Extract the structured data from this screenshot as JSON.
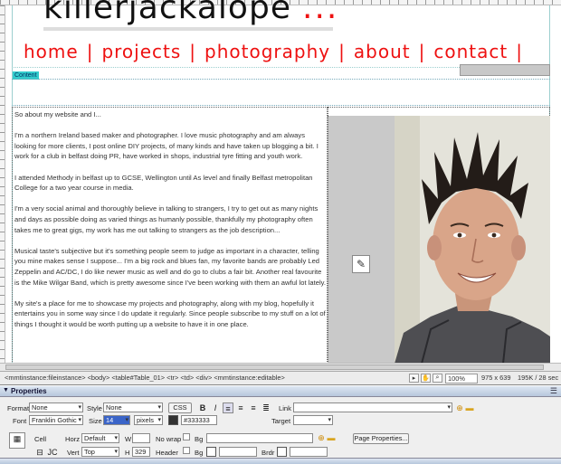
{
  "site": {
    "logo_text": "killerjackalope",
    "logo_dots": "...",
    "nav": [
      {
        "label": "home"
      },
      {
        "label": "projects"
      },
      {
        "label": "photography"
      },
      {
        "label": "about"
      },
      {
        "label": "contact"
      }
    ],
    "nav_separator": "|",
    "content_tag": "Content"
  },
  "article": {
    "paragraphs": [
      "So about my website and I...",
      "I'm a northern Ireland based maker and photographer. I love music photography and am always looking for more clients, I post online DIY projects, of many kinds and have taken up blogging a bit. I work for a club in belfast doing PR, have worked in shops, industrial tyre fitting and youth work.",
      "I attended Methody in belfast up to GCSE, Wellington until As level and finally Belfast metropolitan College for a two year course in media.",
      "I'm a very social animal and thoroughly believe in talking to strangers, I try to get out as many nights and days as possible doing as varied things as humanly possible, thankfully my photography often takes me to great gigs, my work has me out talking to strangers as the job description...",
      "Musical taste's subjective but it's something people seem to judge as important in a character, telling you mine makes sense I suppose... I'm a big rock and blues fan, my favorite bands are probably Led Zeppelin and AC/DC, I do like newer music as well and do go to clubs a fair bit. Another real favourite is the Mike Wilgar Band, which is pretty awesome since I've been working with them an awful lot lately.",
      "My site's a place for me to showcase my projects and photography, along with my blog, hopefully it entertains you in some way since I do update it regularly. Since people subscribe to my stuff on a lot of things I thought it would be worth putting up a website to have it in one place."
    ]
  },
  "status_bar": {
    "tag_path": "<mmtinstance:fileinstance> <body> <table#Table_01> <tr> <td> <div> <mmtinstance:editable>",
    "zoom": "100%",
    "dimensions": "975 x 639",
    "file_info": "195K / 28 sec"
  },
  "properties": {
    "title": "Properties",
    "format_label": "Format",
    "format_value": "None",
    "style_label": "Style",
    "style_value": "None",
    "css_button": "CSS",
    "bold": "B",
    "italic": "I",
    "link_label": "Link",
    "font_label": "Font",
    "font_value": "Franklin Gothic",
    "size_label": "Size",
    "size_value": "14",
    "unit_value": "pixels",
    "color_value": "#333333",
    "target_label": "Target",
    "cell_label": "Cell",
    "horz_label": "Horz",
    "horz_value": "Default",
    "w_label": "W",
    "nowrap_label": "No wrap",
    "bg_label": "Bg",
    "page_props_button": "Page Properties...",
    "vert_label": "Vert",
    "vert_value": "Top",
    "h_label": "H",
    "h_value": "329",
    "header_label": "Header",
    "bg2_label": "Bg",
    "brdr_label": "Brdr",
    "ol_label": "1≡",
    "jc_label": "JC"
  },
  "colors": {
    "nav_red": "#ee1111",
    "guide_cyan": "#33cccc",
    "panel_blue": "#b7c7dc",
    "text_color": "#333333"
  },
  "icons": [
    "hand-icon",
    "zoom-icon",
    "widget-icon",
    "align-left-icon",
    "align-center-icon",
    "align-right-icon",
    "justify-icon",
    "folder-icon",
    "target-icon",
    "merge-icon",
    "split-icon"
  ]
}
